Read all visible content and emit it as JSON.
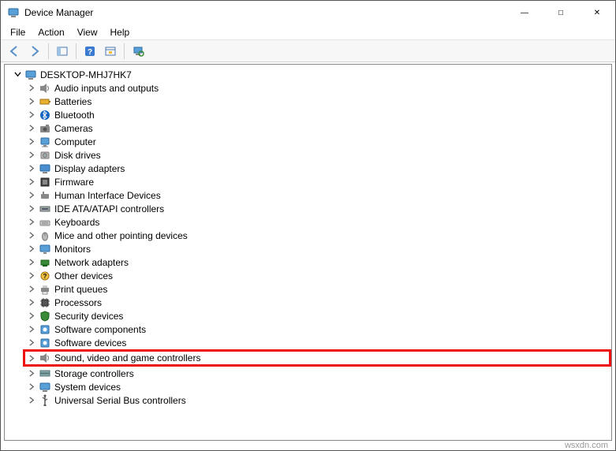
{
  "window": {
    "title": "Device Manager"
  },
  "menu": {
    "file": "File",
    "action": "Action",
    "view": "View",
    "help": "Help"
  },
  "toolbar": {
    "back": "Back",
    "forward": "Forward",
    "show_hide_tree": "Show/Hide Console Tree",
    "help": "Help",
    "properties": "Properties",
    "scan": "Scan for hardware changes"
  },
  "tree": {
    "root": "DESKTOP-MHJ7HK7",
    "items": [
      {
        "label": "Audio inputs and outputs",
        "icon": "audio"
      },
      {
        "label": "Batteries",
        "icon": "battery"
      },
      {
        "label": "Bluetooth",
        "icon": "bluetooth"
      },
      {
        "label": "Cameras",
        "icon": "camera"
      },
      {
        "label": "Computer",
        "icon": "computer"
      },
      {
        "label": "Disk drives",
        "icon": "disk"
      },
      {
        "label": "Display adapters",
        "icon": "display"
      },
      {
        "label": "Firmware",
        "icon": "firmware"
      },
      {
        "label": "Human Interface Devices",
        "icon": "hid"
      },
      {
        "label": "IDE ATA/ATAPI controllers",
        "icon": "ide"
      },
      {
        "label": "Keyboards",
        "icon": "keyboard"
      },
      {
        "label": "Mice and other pointing devices",
        "icon": "mouse"
      },
      {
        "label": "Monitors",
        "icon": "monitor"
      },
      {
        "label": "Network adapters",
        "icon": "network"
      },
      {
        "label": "Other devices",
        "icon": "other"
      },
      {
        "label": "Print queues",
        "icon": "printer"
      },
      {
        "label": "Processors",
        "icon": "cpu"
      },
      {
        "label": "Security devices",
        "icon": "security"
      },
      {
        "label": "Software components",
        "icon": "software"
      },
      {
        "label": "Software devices",
        "icon": "software"
      },
      {
        "label": "Sound, video and game controllers",
        "icon": "audio",
        "highlight": true
      },
      {
        "label": "Storage controllers",
        "icon": "storage"
      },
      {
        "label": "System devices",
        "icon": "system"
      },
      {
        "label": "Universal Serial Bus controllers",
        "icon": "usb"
      }
    ]
  },
  "watermark": "wsxdn.com"
}
